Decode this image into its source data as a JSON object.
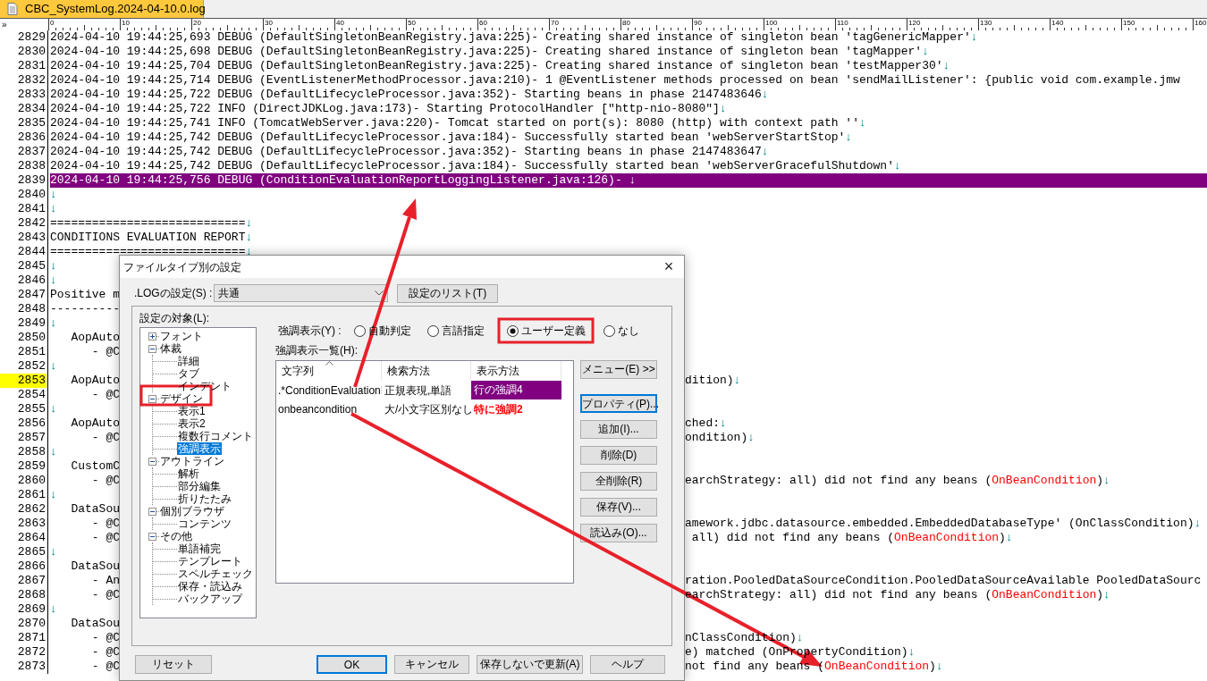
{
  "editor": {
    "tab": {
      "title": "CBC_SystemLog.2024-04-10.0.log",
      "selected": true
    },
    "overflow_mark": "»",
    "ruler": [
      "0",
      "10",
      "20",
      "30",
      "40",
      "50",
      "60",
      "70",
      "80",
      "90",
      "100",
      "110",
      "120",
      "130",
      "140",
      "150",
      "160"
    ],
    "lines": [
      {
        "number": "2829",
        "text": "2024-04-10 19:44:25,693 DEBUG (DefaultSingletonBeanRegistry.java:225)- Creating shared instance of singleton bean 'tagGenericMapper'",
        "eol": "↓",
        "highlighted": false,
        "cursor": false
      },
      {
        "number": "2830",
        "text": "2024-04-10 19:44:25,698 DEBUG (DefaultSingletonBeanRegistry.java:225)- Creating shared instance of singleton bean 'tagMapper'",
        "eol": "↓",
        "highlighted": false,
        "cursor": false
      },
      {
        "number": "2831",
        "text": "2024-04-10 19:44:25,704 DEBUG (DefaultSingletonBeanRegistry.java:225)- Creating shared instance of singleton bean 'testMapper30'",
        "eol": "↓",
        "highlighted": false,
        "cursor": false
      },
      {
        "number": "2832",
        "text": "2024-04-10 19:44:25,714 DEBUG (EventListenerMethodProcessor.java:210)- 1 @EventListener methods processed on bean 'sendMailListener': {public void com.example.jmw",
        "highlighted": false,
        "cursor": false
      },
      {
        "number": "2833",
        "text": "2024-04-10 19:44:25,722 DEBUG (DefaultLifecycleProcessor.java:352)- Starting beans in phase 2147483646",
        "eol": "↓",
        "highlighted": false,
        "cursor": false
      },
      {
        "number": "2834",
        "text": "2024-04-10 19:44:25,722 INFO (DirectJDKLog.java:173)- Starting ProtocolHandler [\"http-nio-8080\"]",
        "eol": "↓",
        "highlighted": false,
        "cursor": false
      },
      {
        "number": "2835",
        "text": "2024-04-10 19:44:25,741 INFO (TomcatWebServer.java:220)- Tomcat started on port(s): 8080 (http) with context path ''",
        "eol": "↓",
        "highlighted": false,
        "cursor": false
      },
      {
        "number": "2836",
        "text": "2024-04-10 19:44:25,742 DEBUG (DefaultLifecycleProcessor.java:184)- Successfully started bean 'webServerStartStop'",
        "eol": "↓",
        "highlighted": false,
        "cursor": false
      },
      {
        "number": "2837",
        "text": "2024-04-10 19:44:25,742 DEBUG (DefaultLifecycleProcessor.java:352)- Starting beans in phase 2147483647",
        "eol": "↓",
        "highlighted": false,
        "cursor": false
      },
      {
        "number": "2838",
        "text": "2024-04-10 19:44:25,742 DEBUG (DefaultLifecycleProcessor.java:184)- Successfully started bean 'webServerGracefulShutdown'",
        "eol": "↓",
        "highlighted": false,
        "cursor": false
      },
      {
        "number": "2839",
        "text": "2024-04-10 19:44:25,756 DEBUG (ConditionEvaluationReportLoggingListener.java:126)- ",
        "eol": "↓",
        "highlighted": true,
        "cursor": false
      },
      {
        "number": "2840",
        "eol": "↓",
        "highlighted": false,
        "cursor": false
      },
      {
        "number": "2841",
        "eol": "↓",
        "highlighted": false,
        "cursor": false
      },
      {
        "number": "2842",
        "text": "============================",
        "eol": "↓",
        "highlighted": false,
        "cursor": false
      },
      {
        "number": "2843",
        "text": "CONDITIONS EVALUATION REPORT",
        "eol": "↓",
        "highlighted": false,
        "cursor": false
      },
      {
        "number": "2844",
        "text": "============================",
        "eol": "↓",
        "highlighted": false,
        "cursor": false
      },
      {
        "number": "2845",
        "eol": "↓",
        "highlighted": false,
        "cursor": false
      },
      {
        "number": "2846",
        "eol": "↓",
        "highlighted": false,
        "cursor": false
      },
      {
        "number": "2847",
        "text": "Positive m",
        "highlighted": false,
        "cursor": false
      },
      {
        "number": "2848",
        "text": "----------",
        "highlighted": false,
        "cursor": false
      },
      {
        "number": "2849",
        "eol": "↓",
        "highlighted": false,
        "cursor": false
      },
      {
        "number": "2850",
        "text": "   AopAuto",
        "highlighted": false,
        "cursor": false
      },
      {
        "number": "2851",
        "text": "      - @C",
        "highlighted": false,
        "cursor": false
      },
      {
        "number": "2852",
        "eol": "↓",
        "highlighted": false,
        "cursor": false
      },
      {
        "number": "2853",
        "text": "   AopAuto",
        "tail": [
          {
            "text": "dition)",
            "match": false
          }
        ],
        "eol": "↓",
        "highlighted": false,
        "cursor": true
      },
      {
        "number": "2854",
        "text": "      - @C",
        "highlighted": false,
        "cursor": false
      },
      {
        "number": "2855",
        "eol": "↓",
        "highlighted": false,
        "cursor": false
      },
      {
        "number": "2856",
        "text": "   AopAuto",
        "tail": [
          {
            "text": "ched:",
            "match": false
          }
        ],
        "eol": "↓",
        "highlighted": false,
        "cursor": false
      },
      {
        "number": "2857",
        "text": "      - @C",
        "tail": [
          {
            "text": "ondition)",
            "match": false
          }
        ],
        "eol": "↓",
        "highlighted": false,
        "cursor": false
      },
      {
        "number": "2858",
        "eol": "↓",
        "highlighted": false,
        "cursor": false
      },
      {
        "number": "2859",
        "text": "   CustomC",
        "highlighted": false,
        "cursor": false
      },
      {
        "number": "2860",
        "text": "      - @C",
        "tail": [
          {
            "text": "earchStrategy: all) did not find any beans (",
            "match": false
          },
          {
            "text": "OnBeanCondition",
            "match": true
          },
          {
            "text": ")",
            "match": false
          }
        ],
        "eol": "↓",
        "highlighted": false,
        "cursor": false
      },
      {
        "number": "2861",
        "eol": "↓",
        "highlighted": false,
        "cursor": false
      },
      {
        "number": "2862",
        "text": "   DataSou",
        "highlighted": false,
        "cursor": false
      },
      {
        "number": "2863",
        "text": "      - @C",
        "tail": [
          {
            "text": "amework.jdbc.datasource.embedded.EmbeddedDatabaseType' (OnClassCondition)",
            "match": false
          }
        ],
        "eol": "↓",
        "highlighted": false,
        "cursor": false
      },
      {
        "number": "2864",
        "text": "      - @C",
        "tail": [
          {
            "text": " all) did not find any beans (",
            "match": false
          },
          {
            "text": "OnBeanCondition",
            "match": true
          },
          {
            "text": ")",
            "match": false
          }
        ],
        "eol": "↓",
        "highlighted": false,
        "cursor": false
      },
      {
        "number": "2865",
        "eol": "↓",
        "highlighted": false,
        "cursor": false
      },
      {
        "number": "2866",
        "text": "   DataSou",
        "highlighted": false,
        "cursor": false
      },
      {
        "number": "2867",
        "text": "      - An",
        "tail": [
          {
            "text": "ration.PooledDataSourceCondition.PooledDataSourceAvailable PooledDataSourc",
            "match": false
          }
        ],
        "highlighted": false,
        "cursor": false
      },
      {
        "number": "2868",
        "text": "      - @C",
        "tail": [
          {
            "text": "earchStrategy: all) did not find any beans (",
            "match": false
          },
          {
            "text": "OnBeanCondition",
            "match": true
          },
          {
            "text": ")",
            "match": false
          }
        ],
        "eol": "↓",
        "highlighted": false,
        "cursor": false
      },
      {
        "number": "2869",
        "eol": "↓",
        "highlighted": false,
        "cursor": false
      },
      {
        "number": "2870",
        "text": "   DataSou",
        "highlighted": false,
        "cursor": false
      },
      {
        "number": "2871",
        "text": "      - @C",
        "tail": [
          {
            "text": "nClassCondition)",
            "match": false
          }
        ],
        "eol": "↓",
        "highlighted": false,
        "cursor": false
      },
      {
        "number": "2872",
        "text": "      - @C",
        "tail": [
          {
            "text": "e) matched (OnPropertyCondition)",
            "match": false
          }
        ],
        "eol": "↓",
        "highlighted": false,
        "cursor": false
      },
      {
        "number": "2873",
        "text": "      - @C",
        "tail": [
          {
            "text": "not find any beans (",
            "match": false
          },
          {
            "text": "OnBeanCondition",
            "match": true
          },
          {
            "text": ")",
            "match": false
          }
        ],
        "eol": "↓",
        "highlighted": false,
        "cursor": false
      }
    ]
  },
  "dialog": {
    "title": "ファイルタイプ別の設定",
    "close": "×",
    "filetype_label": ".LOGの設定(S) :",
    "filetype_value": "共通",
    "list_button": "設定のリスト(T)",
    "tree_label": "設定の対象(L):",
    "tree": [
      {
        "label": "フォント",
        "expanded": false,
        "selected": false
      },
      {
        "label": "体裁",
        "expanded": true,
        "selected": false,
        "children": [
          {
            "label": "詳細",
            "selected": false
          },
          {
            "label": "タブ",
            "selected": false
          },
          {
            "label": "インデント",
            "selected": false
          }
        ]
      },
      {
        "label": "デザイン",
        "expanded": true,
        "selected": false,
        "children": [
          {
            "label": "表示1",
            "selected": false
          },
          {
            "label": "表示2",
            "selected": false
          },
          {
            "label": "複数行コメント",
            "selected": false
          },
          {
            "label": "強調表示",
            "selected": true
          }
        ]
      },
      {
        "label": "アウトライン",
        "expanded": true,
        "selected": false,
        "children": [
          {
            "label": "解析",
            "selected": false
          },
          {
            "label": "部分編集",
            "selected": false
          },
          {
            "label": "折りたたみ",
            "selected": false
          }
        ]
      },
      {
        "label": "個別ブラウザ",
        "expanded": true,
        "selected": false,
        "children": [
          {
            "label": "コンテンツ",
            "selected": false
          }
        ]
      },
      {
        "label": "その他",
        "expanded": true,
        "selected": false,
        "children": [
          {
            "label": "単語補完",
            "selected": false
          },
          {
            "label": "テンプレート",
            "selected": false
          },
          {
            "label": "スペルチェック",
            "selected": false
          },
          {
            "label": "保存・読込み",
            "selected": false
          },
          {
            "label": "バックアップ",
            "selected": false
          }
        ]
      }
    ],
    "highlight_label": "強調表示(Y) :",
    "highlight_modes": [
      {
        "label": "自動判定",
        "selected": false
      },
      {
        "label": "言語指定",
        "selected": false
      },
      {
        "label": "ユーザー定義",
        "selected": true
      },
      {
        "label": "なし",
        "selected": false
      }
    ],
    "list_label": "強調表示一覧(H):",
    "columns": [
      "文字列",
      "検索方法",
      "表示方法"
    ],
    "rows": [
      {
        "string": ".*ConditionEvaluationI",
        "method": "正規表現,単語",
        "style": "行の強調4",
        "kind": "line",
        "color": "#800080"
      },
      {
        "string": "onbeancondition",
        "method": "大/小文字区別なし",
        "style": "特に強調2",
        "kind": "text",
        "color": "#ff0000"
      }
    ],
    "side_buttons": [
      {
        "label": "メニュー(E) >>",
        "focused": false
      },
      {
        "label": "プロパティ(P)...",
        "focused": true
      },
      {
        "label": "追加(I)...",
        "focused": false
      },
      {
        "label": "削除(D)",
        "focused": false
      },
      {
        "label": "全削除(R)",
        "focused": false
      },
      {
        "label": "保存(V)...",
        "focused": false
      },
      {
        "label": "読込み(O)...",
        "focused": false
      }
    ],
    "reset_button": {
      "label": "リセット",
      "focused": false
    },
    "footer_buttons": [
      {
        "label": "OK",
        "focused": true
      },
      {
        "label": "キャンセル",
        "focused": false
      },
      {
        "label": "保存しないで更新(A)",
        "focused": false
      },
      {
        "label": "ヘルプ",
        "focused": false
      }
    ]
  }
}
